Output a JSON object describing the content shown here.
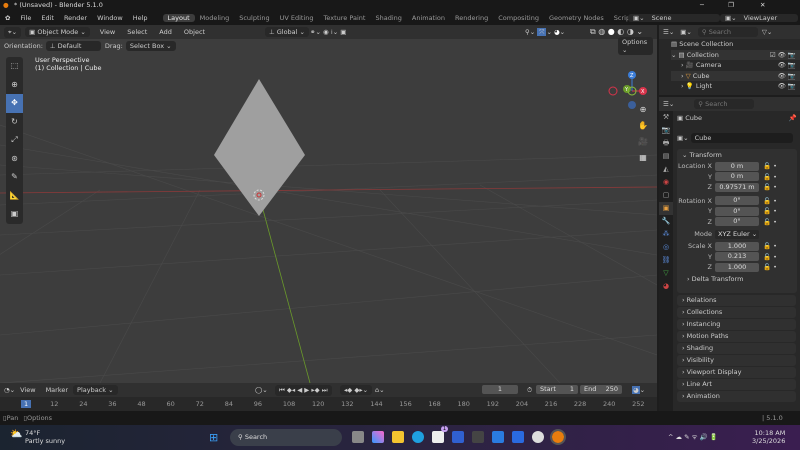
{
  "window": {
    "title": "* (Unsaved) - Blender 5.1.0",
    "min": "─",
    "max": "❐",
    "close": "✕"
  },
  "menu": [
    "File",
    "Edit",
    "Render",
    "Window",
    "Help"
  ],
  "workspaces": [
    "Layout",
    "Modeling",
    "Sculpting",
    "UV Editing",
    "Texture Paint",
    "Shading",
    "Animation",
    "Rendering",
    "Compositing",
    "Geometry Nodes",
    "Scripting",
    "+"
  ],
  "scene": "Scene",
  "view_layer": "ViewLayer",
  "viewport": {
    "mode": "Object Mode",
    "menus": [
      "View",
      "Select",
      "Add",
      "Object"
    ],
    "orientation_label": "Orientation:",
    "orientation": "Default",
    "drag_label": "Drag:",
    "drag": "Select Box",
    "transform": "Global",
    "options": "Options",
    "perspective": "User Perspective",
    "context": "(1) Collection | Cube",
    "gizmo": {
      "x": "X",
      "y": "Y",
      "z": "Z"
    }
  },
  "outliner": {
    "search": "Search",
    "scene_collection": "Scene Collection",
    "collection": "Collection",
    "items": [
      "Camera",
      "Cube",
      "Light"
    ]
  },
  "properties": {
    "search": "Search",
    "object_name": "Cube",
    "data_name": "Cube",
    "transform": "Transform",
    "location_label": "Location X",
    "rotation_label": "Rotation X",
    "scale_label": "Scale X",
    "mode_label": "Mode",
    "y": "Y",
    "z": "Z",
    "location": [
      "0 m",
      "0 m",
      "0.97571 m"
    ],
    "rotation": [
      "0°",
      "0°",
      "0°"
    ],
    "mode": "XYZ Euler",
    "scale": [
      "1.000",
      "0.213",
      "1.000"
    ],
    "panels": [
      "Delta Transform",
      "Relations",
      "Collections",
      "Instancing",
      "Motion Paths",
      "Shading",
      "Visibility",
      "Viewport Display",
      "Line Art",
      "Animation"
    ]
  },
  "timeline": {
    "menus": [
      "View",
      "Marker",
      "Playback"
    ],
    "current_frame": "1",
    "start_label": "Start",
    "start": "1",
    "end_label": "End",
    "end": "250",
    "ticks": [
      "1",
      "12",
      "24",
      "36",
      "48",
      "60",
      "72",
      "84",
      "96",
      "108",
      "120",
      "132",
      "144",
      "156",
      "168",
      "180",
      "192",
      "204",
      "216",
      "228",
      "240",
      "252"
    ]
  },
  "status": {
    "pan": "Pan",
    "options": "Options",
    "version": "5.1.0"
  },
  "taskbar": {
    "weather_temp": "74°F",
    "weather_desc": "Partly sunny",
    "search": "Search",
    "time": "10:18 AM",
    "date": "3/25/2026",
    "badge": "1"
  }
}
